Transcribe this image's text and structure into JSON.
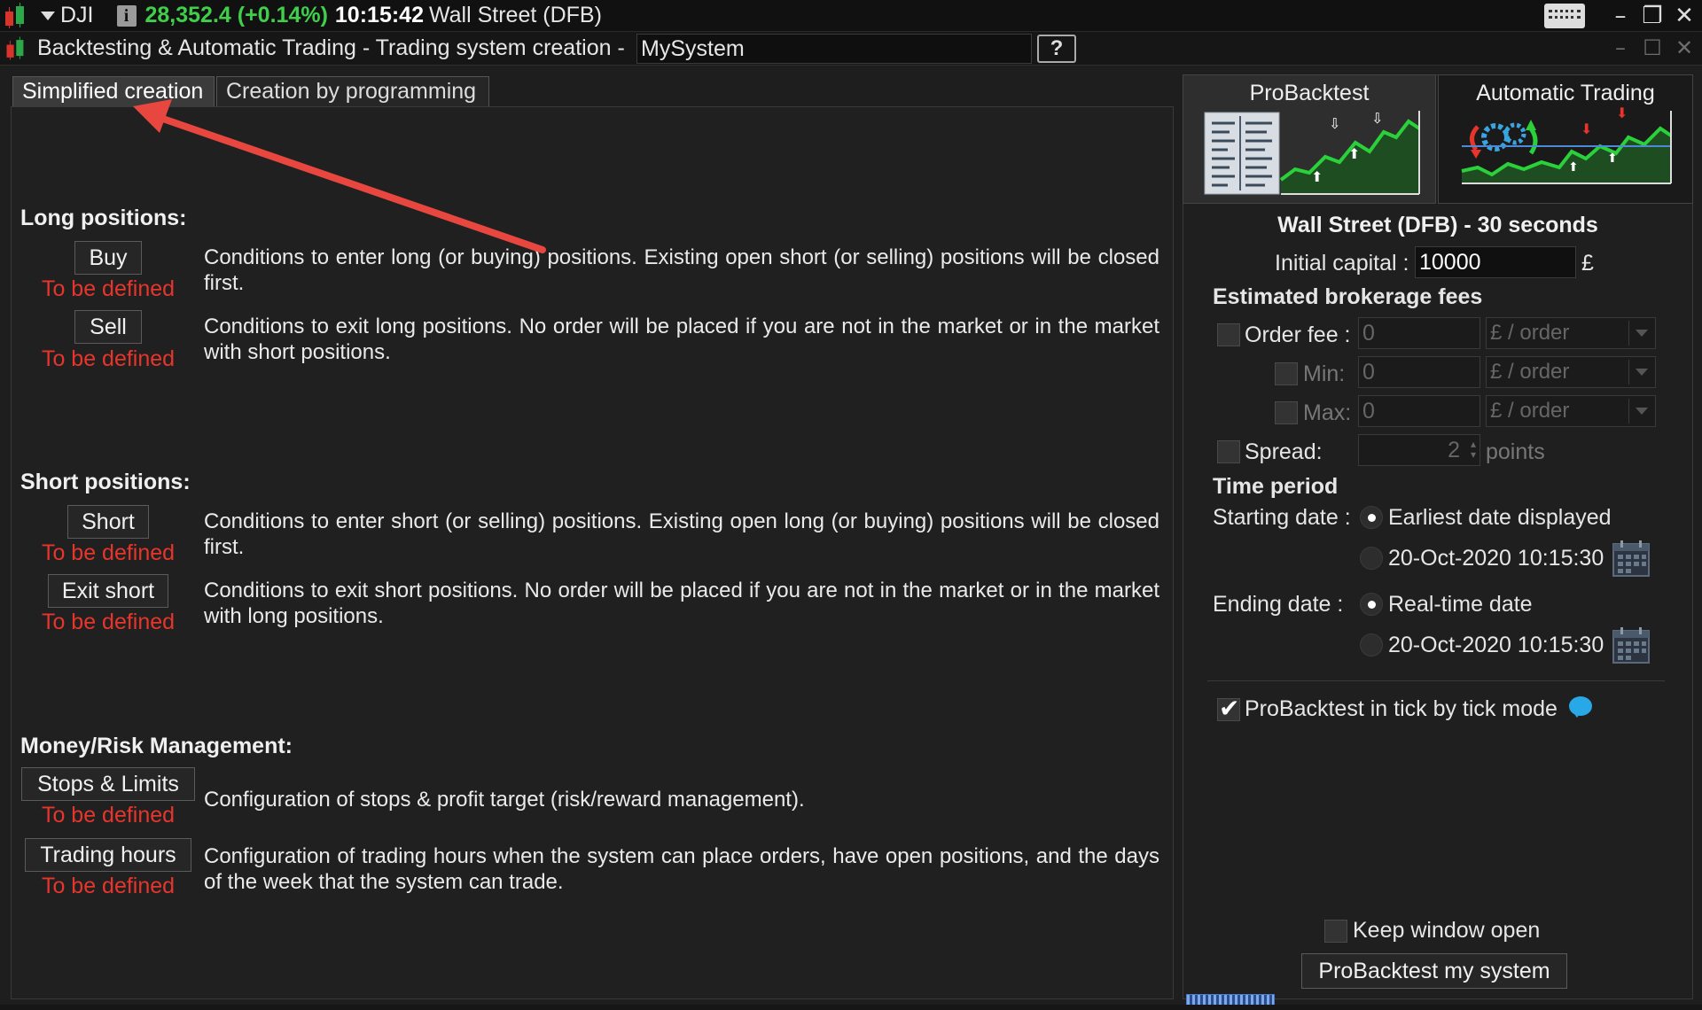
{
  "top_bar": {
    "symbol": "DJI",
    "info_glyph": "i",
    "quote": "28,352.4 (+0.14%)",
    "time": "10:15:42",
    "instrument": "Wall Street (DFB)"
  },
  "window": {
    "title": "Backtesting & Automatic Trading - Trading system creation -",
    "system_name": "MySystem",
    "help_glyph": "?"
  },
  "tabs": {
    "simplified": "Simplified creation",
    "programming": "Creation by programming"
  },
  "long": {
    "heading": "Long positions:",
    "buy_label": "Buy",
    "buy_status": "To be defined",
    "buy_desc": "Conditions to enter long (or buying) positions. Existing open short (or selling) positions will be closed first.",
    "sell_label": "Sell",
    "sell_status": "To be defined",
    "sell_desc": "Conditions to exit long positions.  No order will be placed if you are not in the market or in the market with short positions."
  },
  "short": {
    "heading": "Short positions:",
    "short_label": "Short",
    "short_status": "To be defined",
    "short_desc": "Conditions to enter short (or selling) positions. Existing open long (or buying) positions will be closed first.",
    "exit_label": "Exit short",
    "exit_status": "To be defined",
    "exit_desc": "Conditions to exit short positions.  No order will be placed if you are not in the market or in the market with long positions."
  },
  "money": {
    "heading": "Money/Risk Management:",
    "stops_label": "Stops & Limits",
    "stops_status": "To be defined",
    "stops_desc": "Configuration of stops & profit target (risk/reward management).",
    "hours_label": "Trading hours",
    "hours_status": "To be defined",
    "hours_desc": "Configuration of trading hours when the system can place orders, have open positions, and the days of the week that the system can trade."
  },
  "right": {
    "tab_probacktest": "ProBacktest",
    "tab_auto": "Automatic Trading",
    "title": "Wall Street (DFB) - 30 seconds",
    "capital_label": "Initial capital :",
    "capital_value": "10000",
    "currency": "£",
    "fees_heading": "Estimated brokerage fees",
    "order_fee_label": "Order fee :",
    "order_fee_value": "0",
    "order_fee_unit": "£ / order",
    "min_label": "Min:",
    "min_value": "0",
    "min_unit": "£ / order",
    "max_label": "Max:",
    "max_value": "0",
    "max_unit": "£ / order",
    "spread_label": "Spread:",
    "spread_value": "2",
    "spread_unit": "points",
    "period_heading": "Time period",
    "start_label": "Starting date :",
    "start_opt1": "Earliest date displayed",
    "start_opt2": "20-Oct-2020 10:15:30",
    "end_label": "Ending date :",
    "end_opt1": "Real-time date",
    "end_opt2": "20-Oct-2020 10:15:30",
    "tick_mode_label": "ProBacktest in tick by tick mode",
    "keep_open_label": "Keep window open",
    "run_button": "ProBacktest my system"
  },
  "colors": {
    "quote_green": "#3fcf4a",
    "status_red": "#e8352c",
    "annotation_arrow": "#e8473f"
  },
  "icons": [
    "candlestick-icon",
    "dropdown-arrow-icon",
    "info-icon",
    "keyboard-icon",
    "minimize-icon",
    "restore-icon",
    "close-icon",
    "help-icon",
    "calendar-icon",
    "info-bubble-icon"
  ]
}
